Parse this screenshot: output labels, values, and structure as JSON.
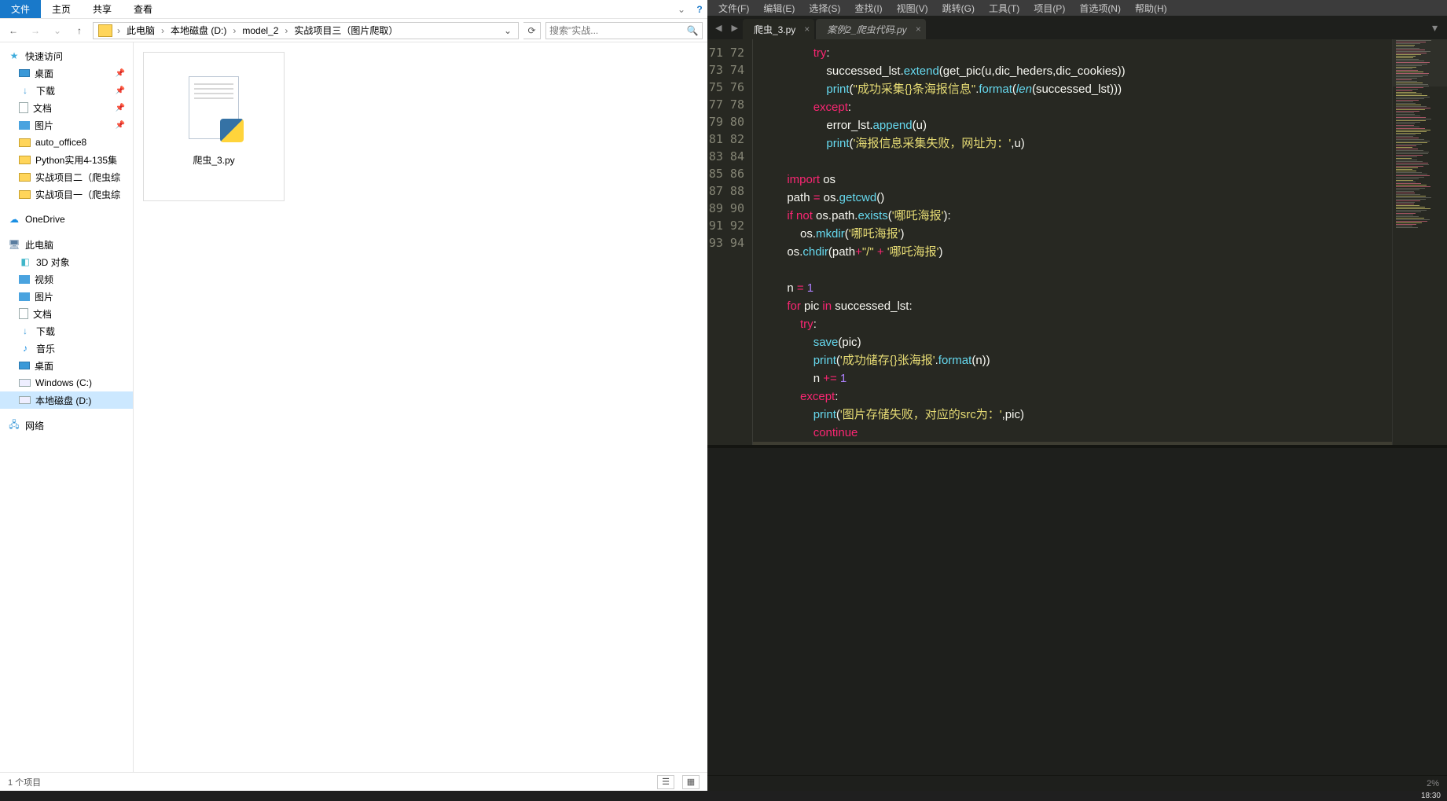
{
  "explorer": {
    "ribbon": {
      "file": "文件",
      "home": "主页",
      "share": "共享",
      "view": "查看"
    },
    "breadcrumbs": [
      "此电脑",
      "本地磁盘 (D:)",
      "model_2",
      "实战项目三（图片爬取）"
    ],
    "search_placeholder": "搜索\"实战...",
    "tree": {
      "quick": "快速访问",
      "desktop": "桌面",
      "downloads": "下载",
      "documents": "文档",
      "pictures": "图片",
      "auto_office": "auto_office8",
      "python_practical": "Python实用4-135集",
      "proj2": "实战项目二（爬虫综",
      "proj1": "实战项目一（爬虫综",
      "onedrive": "OneDrive",
      "thispc": "此电脑",
      "d3": "3D 对象",
      "videos": "视频",
      "pictures2": "图片",
      "documents2": "文档",
      "downloads2": "下载",
      "music": "音乐",
      "desktop2": "桌面",
      "c_drive": "Windows (C:)",
      "d_drive": "本地磁盘 (D:)",
      "network": "网络"
    },
    "file_name": "爬虫_3.py",
    "status_count": "1 个项目"
  },
  "editor": {
    "menu": {
      "file": "文件(F)",
      "edit": "编辑(E)",
      "select": "选择(S)",
      "find": "查找(I)",
      "view": "视图(V)",
      "goto": "跳转(G)",
      "tools": "工具(T)",
      "project": "项目(P)",
      "prefs": "首选项(N)",
      "help": "帮助(H)"
    },
    "tabs": {
      "active": "爬虫_3.py",
      "other": "案例2_爬虫代码.py"
    },
    "status_right": "2%",
    "code": {
      "l71": {
        "indent": "                ",
        "kw": "try",
        "pu": ":"
      },
      "l72": {
        "indent": "                    ",
        "v1": "successed_lst",
        "op1": ".",
        "fn": "extend",
        "pu1": "(",
        "v2": "get_pic",
        "pu2": "(",
        "v3": "u",
        "pu3": ",",
        "v4": "dic_heders",
        "pu4": ",",
        "v5": "dic_cookies",
        "pu5": "))"
      },
      "l73": {
        "indent": "                    ",
        "fn": "print",
        "pu1": "(",
        "s1": "\"成功采集{}条海报信息\"",
        "op1": ".",
        "fn2": "format",
        "pu2": "(",
        "fn3": "len",
        "pu3": "(",
        "v1": "successed_lst",
        "pu4": ")))"
      },
      "l74": {
        "indent": "                ",
        "kw": "except",
        "pu": ":"
      },
      "l75": {
        "indent": "                    ",
        "v1": "error_lst",
        "op1": ".",
        "fn": "append",
        "pu1": "(",
        "v2": "u",
        "pu2": ")"
      },
      "l76": {
        "indent": "                    ",
        "fn": "print",
        "pu1": "(",
        "s1": "'海报信息采集失败，网址为：'",
        "pu2": ",",
        "v1": "u",
        "pu3": ")"
      },
      "l78": {
        "indent": "        ",
        "kw": "import",
        "sp": " ",
        "v1": "os"
      },
      "l79": {
        "indent": "        ",
        "v1": "path",
        "sp1": " ",
        "op1": "=",
        "sp2": " ",
        "v2": "os",
        "op2": ".",
        "fn": "getcwd",
        "pu": "()"
      },
      "l80": {
        "indent": "        ",
        "kw1": "if",
        "sp1": " ",
        "kw2": "not",
        "sp2": " ",
        "v1": "os",
        "op1": ".",
        "v2": "path",
        "op2": ".",
        "fn": "exists",
        "pu1": "(",
        "s1": "'哪吒海报'",
        "pu2": "):"
      },
      "l81": {
        "indent": "            ",
        "v1": "os",
        "op1": ".",
        "fn": "mkdir",
        "pu1": "(",
        "s1": "'哪吒海报'",
        "pu2": ")"
      },
      "l82": {
        "indent": "        ",
        "v1": "os",
        "op1": ".",
        "fn": "chdir",
        "pu1": "(",
        "v2": "path",
        "op2": "+",
        "s1": "\"/\"",
        "sp": " ",
        "op3": "+",
        "sp2": " ",
        "s2": "'哪吒海报'",
        "pu2": ")"
      },
      "l84": {
        "indent": "        ",
        "v1": "n",
        "sp1": " ",
        "op1": "=",
        "sp2": " ",
        "n1": "1"
      },
      "l85": {
        "indent": "        ",
        "kw1": "for",
        "sp1": " ",
        "v1": "pic",
        "sp2": " ",
        "kw2": "in",
        "sp3": " ",
        "v2": "successed_lst",
        "pu": ":"
      },
      "l86": {
        "indent": "            ",
        "kw": "try",
        "pu": ":"
      },
      "l87": {
        "indent": "                ",
        "fn": "save",
        "pu1": "(",
        "v1": "pic",
        "pu2": ")"
      },
      "l88": {
        "indent": "                ",
        "fn": "print",
        "pu1": "(",
        "s1": "'成功储存{}张海报'",
        "op1": ".",
        "fn2": "format",
        "pu2": "(",
        "v1": "n",
        "pu3": "))"
      },
      "l89": {
        "indent": "                ",
        "v1": "n",
        "sp1": " ",
        "op1": "+=",
        "sp2": " ",
        "n1": "1"
      },
      "l90": {
        "indent": "            ",
        "kw": "except",
        "pu": ":"
      },
      "l91": {
        "indent": "                ",
        "fn": "print",
        "pu1": "(",
        "s1": "'图片存储失败，对应的src为：'",
        "pu2": ",",
        "v1": "pic",
        "pu3": ")"
      },
      "l92": {
        "indent": "                ",
        "kw": "continue"
      }
    },
    "line_numbers": [
      "71",
      "72",
      "73",
      "74",
      "75",
      "76",
      "77",
      "78",
      "79",
      "80",
      "81",
      "82",
      "83",
      "84",
      "85",
      "86",
      "87",
      "88",
      "89",
      "90",
      "91",
      "92",
      "93",
      "94"
    ]
  },
  "taskbar": {
    "time": "18:30"
  }
}
